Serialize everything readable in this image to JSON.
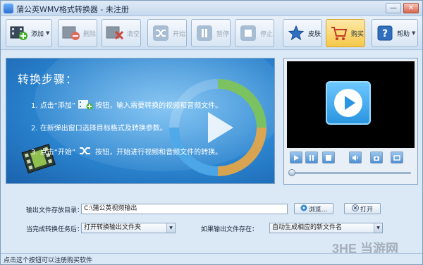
{
  "window": {
    "title": "蒲公英WMV格式转换器 - 未注册",
    "minimize": "—",
    "close": "✕"
  },
  "toolbar": {
    "add": "添加",
    "delete": "删除",
    "clear": "清空",
    "start": "开始",
    "pause": "暂停",
    "stop": "停止",
    "skin": "皮肤",
    "buy": "购买",
    "help": "帮助"
  },
  "steps": {
    "title": "转换步骤：",
    "step1_pre": "1. 点击“添加”",
    "step1_post": "按钮，输入需要转换的视频和音频文件。",
    "step2": "2. 在新弹出窗口选择目标格式及转换参数。",
    "step3_pre": "3. 点击“开始”",
    "step3_post": "按钮，开始进行视频和音频文件的转换。"
  },
  "settings": {
    "output_dir_label": "输出文件存放目录：",
    "output_dir_value": "C:\\蒲公英视频输出",
    "browse_label": "浏览...",
    "open_label": "打开",
    "after_label": "当完成转换任务后：",
    "after_value": "打开转换输出文件夹",
    "exists_label": "如果输出文件存在：",
    "exists_value": "自动生成相应的新文件名"
  },
  "status": {
    "text": "点击这个按钮可以注册购买软件"
  },
  "watermark": {
    "text": "3HE 当游网"
  },
  "player": {
    "progress": 0
  },
  "colors": {
    "accent": "#2b85d0",
    "buy_highlight": "#f5c84a",
    "banner_bg": "#1b62ad"
  }
}
